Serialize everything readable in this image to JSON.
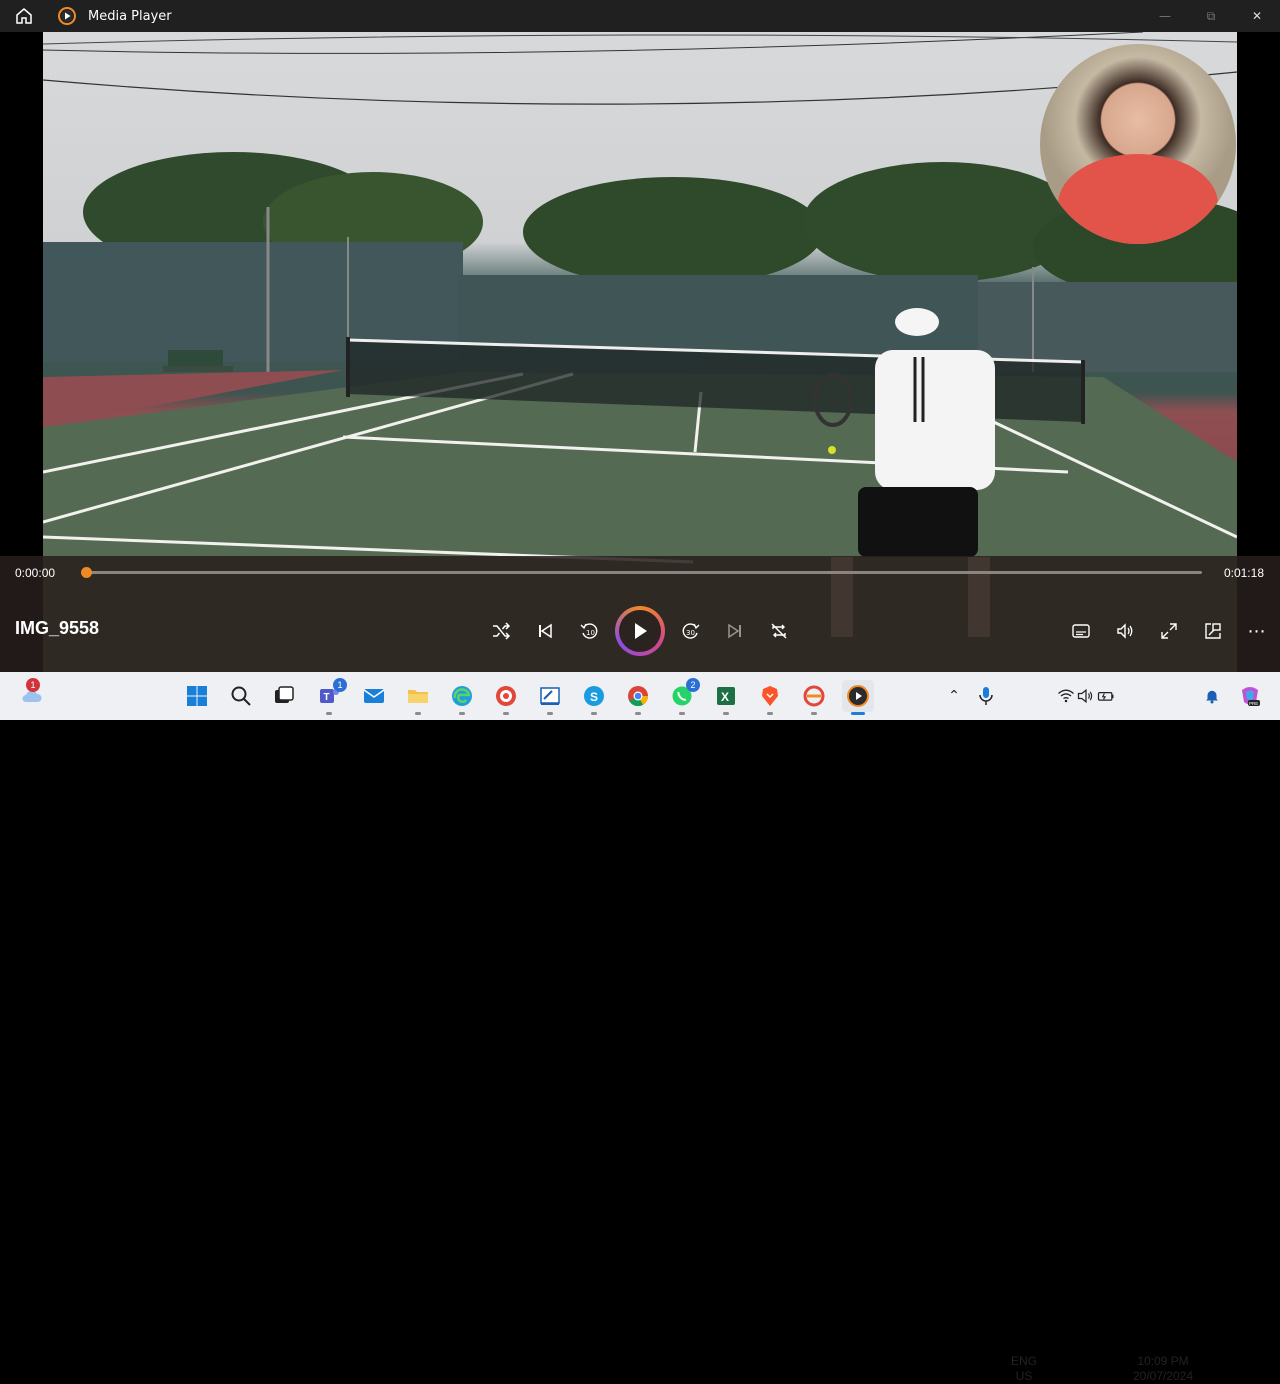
{
  "window": {
    "title": "Media Player"
  },
  "player": {
    "current_time": "0:00:00",
    "duration": "0:01:18",
    "progress": 0,
    "media_title": "IMG_9558"
  },
  "taskbar": {
    "weather_badge": "1",
    "teams_badge": "1",
    "whatsapp_badge": "2",
    "language_line1": "ENG",
    "language_line2": "US",
    "clock_time": "10:09 PM",
    "clock_date": "20/07/2024"
  },
  "colors": {
    "accent": "#f08a24",
    "titlebar": "#202020",
    "taskbar": "#eef0f4"
  }
}
